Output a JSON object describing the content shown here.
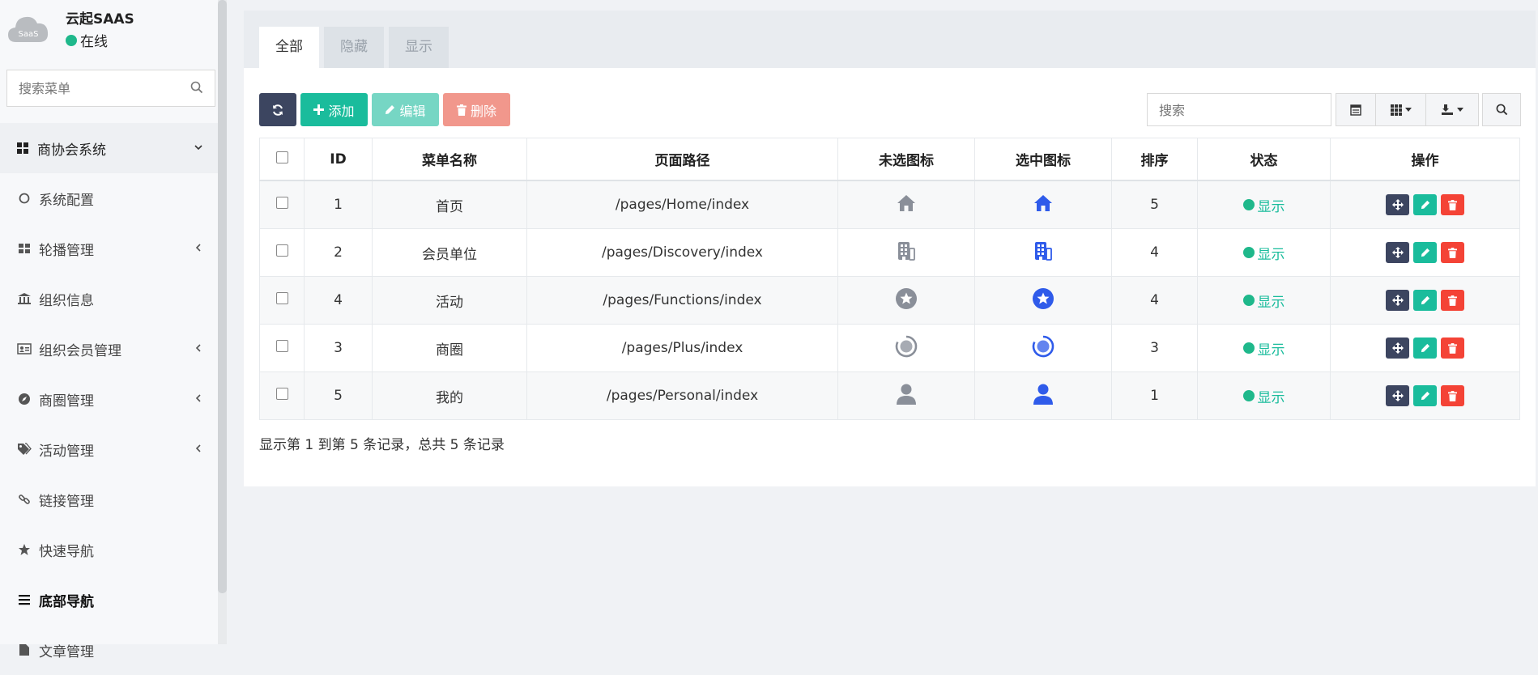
{
  "user": {
    "name": "云起SAAS",
    "status": "在线",
    "avatar_text": "SaaS"
  },
  "sidebar": {
    "search_placeholder": "搜索菜单",
    "items": [
      {
        "label": "商协会系统",
        "icon": "dashboard-icon",
        "type": "header",
        "chevron": "down"
      },
      {
        "label": "系统配置",
        "icon": "circle-icon"
      },
      {
        "label": "轮播管理",
        "icon": "grid-icon",
        "chevron": "left"
      },
      {
        "label": "组织信息",
        "icon": "bank-icon"
      },
      {
        "label": "组织会员管理",
        "icon": "id-card-icon",
        "chevron": "left"
      },
      {
        "label": "商圈管理",
        "icon": "compass-icon",
        "chevron": "left"
      },
      {
        "label": "活动管理",
        "icon": "tags-icon",
        "chevron": "left"
      },
      {
        "label": "链接管理",
        "icon": "link-icon"
      },
      {
        "label": "快速导航",
        "icon": "star-icon"
      },
      {
        "label": "底部导航",
        "icon": "bars-icon",
        "active": true
      },
      {
        "label": "文章管理",
        "icon": "file-icon"
      }
    ]
  },
  "tabs": [
    "全部",
    "隐藏",
    "显示"
  ],
  "toolbar": {
    "add_label": "添加",
    "edit_label": "编辑",
    "delete_label": "删除",
    "search_placeholder": "搜索"
  },
  "table": {
    "headers": [
      "ID",
      "菜单名称",
      "页面路径",
      "未选图标",
      "选中图标",
      "排序",
      "状态",
      "操作"
    ],
    "rows": [
      {
        "id": "1",
        "name": "首页",
        "path": "/pages/Home/index",
        "icon": "home",
        "sort": "5",
        "status": "显示"
      },
      {
        "id": "2",
        "name": "会员单位",
        "path": "/pages/Discovery/index",
        "icon": "building",
        "sort": "4",
        "status": "显示"
      },
      {
        "id": "4",
        "name": "活动",
        "path": "/pages/Functions/index",
        "icon": "star",
        "sort": "4",
        "status": "显示"
      },
      {
        "id": "3",
        "name": "商圈",
        "path": "/pages/Plus/index",
        "icon": "ring",
        "sort": "3",
        "status": "显示"
      },
      {
        "id": "5",
        "name": "我的",
        "path": "/pages/Personal/index",
        "icon": "person",
        "sort": "1",
        "status": "显示"
      }
    ]
  },
  "footer": {
    "summary": "显示第 1 到第 5 条记录，总共 5 条记录"
  },
  "colors": {
    "accent": "#1abc9c",
    "dark": "#3c4560",
    "danger": "#f44336",
    "icon_gray": "#8a8f99",
    "icon_blue": "#2f5bea"
  }
}
